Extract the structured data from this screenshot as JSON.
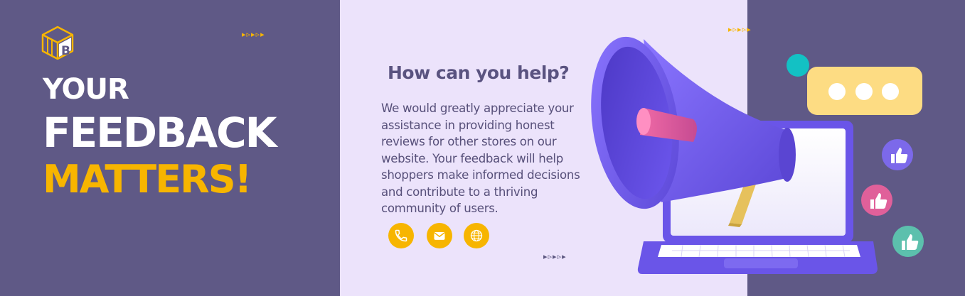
{
  "headline": {
    "line1": "YOUR",
    "line2": "FEEDBACK",
    "line3": "MATTERS!"
  },
  "help": {
    "title": "How can you help?",
    "body": "We would greatly appreciate your assistance in providing honest reviews for other stores on our website. Your feedback will help shoppers make informed decisions and contribute to a thriving community of users."
  },
  "decorations": {
    "arrows": "▸▹▸▹▸",
    "logo_letter": "B"
  },
  "icons": [
    "logo-icon",
    "phone-icon",
    "mail-icon",
    "globe-icon",
    "megaphone-icon",
    "laptop-icon",
    "chat-bubble-icon",
    "thumbs-up-icon"
  ],
  "colors": {
    "side_panel": "#5f5986",
    "center_panel": "#ece3fb",
    "accent_yellow": "#f7b500",
    "text_purple": "#57507a",
    "megaphone_purple": "#6b55e6",
    "bubble_yellow": "#fddc83"
  }
}
